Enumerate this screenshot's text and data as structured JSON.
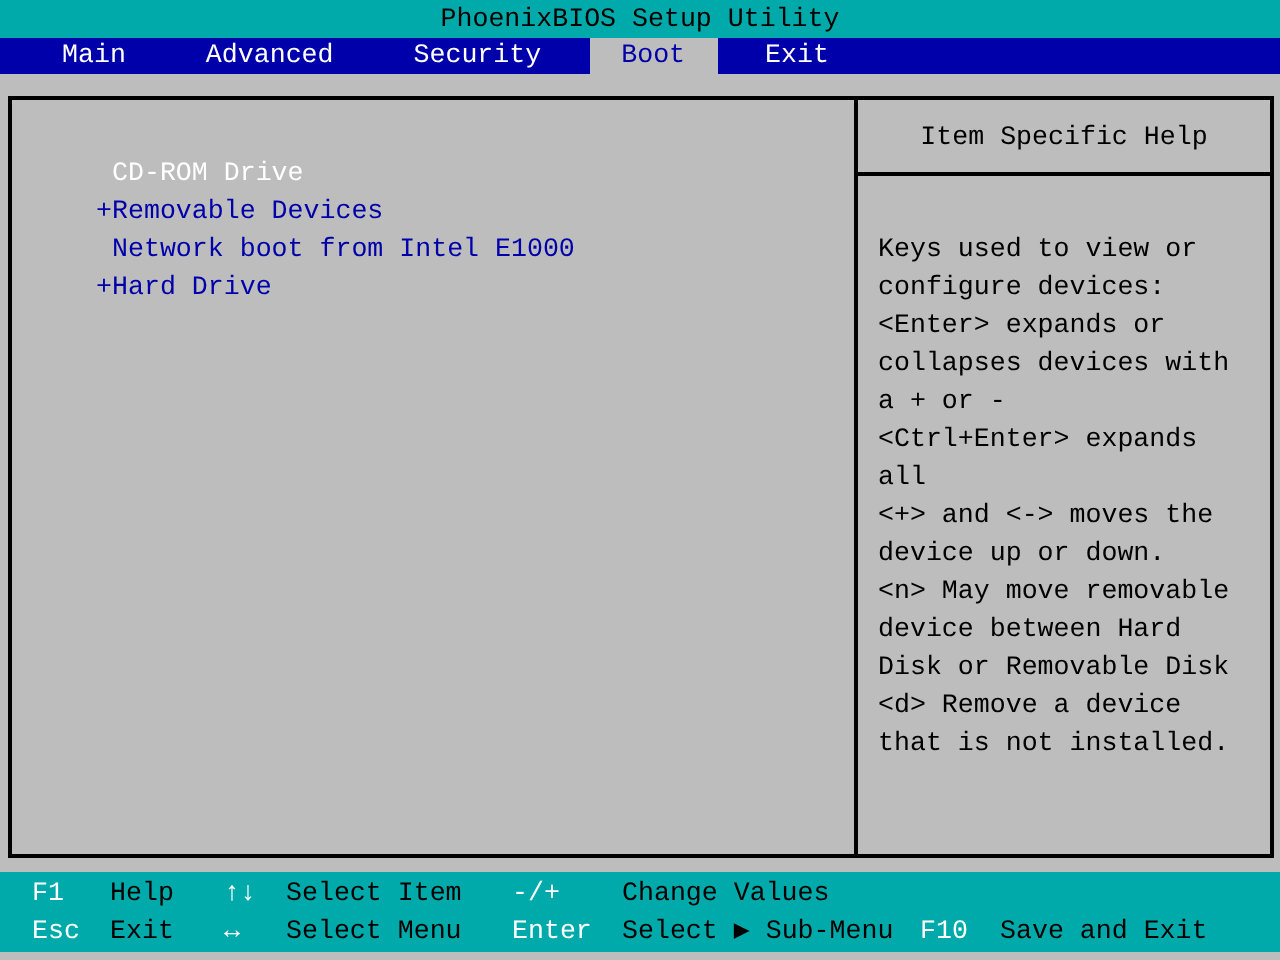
{
  "window": {
    "title": "PhoenixBIOS Setup Utility"
  },
  "tabs": [
    {
      "label": "Main",
      "selected": false
    },
    {
      "label": "Advanced",
      "selected": false
    },
    {
      "label": "Security",
      "selected": false
    },
    {
      "label": "Boot",
      "selected": true
    },
    {
      "label": "Exit",
      "selected": false
    }
  ],
  "boot_items": [
    {
      "marker": "",
      "label": "CD-ROM Drive",
      "selected": true
    },
    {
      "marker": "+",
      "label": "Removable Devices",
      "selected": false
    },
    {
      "marker": "",
      "label": "Network boot from Intel E1000",
      "selected": false
    },
    {
      "marker": "+",
      "label": "Hard Drive",
      "selected": false
    }
  ],
  "help": {
    "title": "Item Specific Help",
    "text": "Keys used to view or\nconfigure devices:\n<Enter> expands or\ncollapses devices with\na + or -\n<Ctrl+Enter> expands\nall\n<+> and <-> moves the\ndevice up or down.\n<n> May move removable\ndevice between Hard\nDisk or Removable Disk\n<d> Remove a device\nthat is not installed."
  },
  "status_bar": [
    [
      {
        "key": "F1",
        "action": "Help"
      },
      {
        "key": "↑↓",
        "action": "Select Item"
      },
      {
        "key": "-/+",
        "action": "Change Values"
      }
    ],
    [
      {
        "key": "Esc",
        "action": "Exit"
      },
      {
        "key": "↔",
        "action": "Select Menu"
      },
      {
        "key": "Enter",
        "action": "Select ▶ Sub-Menu"
      },
      {
        "key": "F10",
        "action": "Save and Exit"
      }
    ]
  ]
}
